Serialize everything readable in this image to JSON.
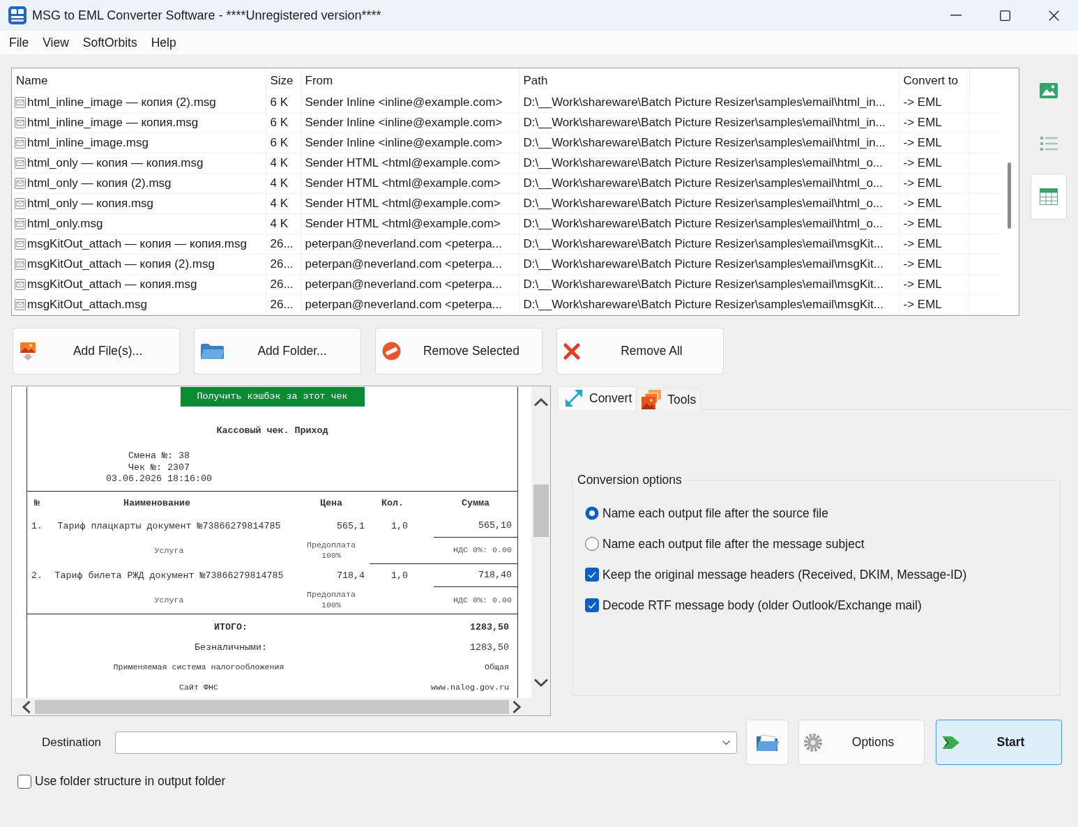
{
  "window": {
    "title": "MSG to EML Converter Software - ****Unregistered version****"
  },
  "menu": [
    {
      "label": "File"
    },
    {
      "label": "View"
    },
    {
      "label": "SoftOrbits"
    },
    {
      "label": "Help"
    }
  ],
  "file_table": {
    "columns": [
      "Name",
      "Size",
      "From",
      "Path",
      "Convert to"
    ],
    "rows": [
      {
        "name": "html_inline_image — копия (2).msg",
        "size": "6 K",
        "from": "Sender Inline <inline@example.com>",
        "path": "D:\\__Work\\shareware\\Batch Picture Resizer\\samples\\email\\html_in...",
        "convert_to": "-> EML"
      },
      {
        "name": "html_inline_image — копия.msg",
        "size": "6 K",
        "from": "Sender Inline <inline@example.com>",
        "path": "D:\\__Work\\shareware\\Batch Picture Resizer\\samples\\email\\html_in...",
        "convert_to": "-> EML"
      },
      {
        "name": "html_inline_image.msg",
        "size": "6 K",
        "from": "Sender Inline <inline@example.com>",
        "path": "D:\\__Work\\shareware\\Batch Picture Resizer\\samples\\email\\html_in...",
        "convert_to": "-> EML"
      },
      {
        "name": "html_only — копия — копия.msg",
        "size": "4 K",
        "from": "Sender HTML <html@example.com>",
        "path": "D:\\__Work\\shareware\\Batch Picture Resizer\\samples\\email\\html_o...",
        "convert_to": "-> EML"
      },
      {
        "name": "html_only — копия (2).msg",
        "size": "4 K",
        "from": "Sender HTML <html@example.com>",
        "path": "D:\\__Work\\shareware\\Batch Picture Resizer\\samples\\email\\html_o...",
        "convert_to": "-> EML"
      },
      {
        "name": "html_only — копия.msg",
        "size": "4 K",
        "from": "Sender HTML <html@example.com>",
        "path": "D:\\__Work\\shareware\\Batch Picture Resizer\\samples\\email\\html_o...",
        "convert_to": "-> EML"
      },
      {
        "name": "html_only.msg",
        "size": "4 K",
        "from": "Sender HTML <html@example.com>",
        "path": "D:\\__Work\\shareware\\Batch Picture Resizer\\samples\\email\\html_o...",
        "convert_to": "-> EML"
      },
      {
        "name": "msgKitOut_attach — копия — копия.msg",
        "size": "26...",
        "from": "peterpan@neverland.com <peterpa...",
        "path": "D:\\__Work\\shareware\\Batch Picture Resizer\\samples\\email\\msgKit...",
        "convert_to": "-> EML"
      },
      {
        "name": "msgKitOut_attach — копия (2).msg",
        "size": "26...",
        "from": "peterpan@neverland.com <peterpa...",
        "path": "D:\\__Work\\shareware\\Batch Picture Resizer\\samples\\email\\msgKit...",
        "convert_to": "-> EML"
      },
      {
        "name": "msgKitOut_attach — копия.msg",
        "size": "26...",
        "from": "peterpan@neverland.com <peterpa...",
        "path": "D:\\__Work\\shareware\\Batch Picture Resizer\\samples\\email\\msgKit...",
        "convert_to": "-> EML"
      },
      {
        "name": "msgKitOut_attach.msg",
        "size": "26...",
        "from": "peterpan@neverland.com <peterpa...",
        "path": "D:\\__Work\\shareware\\Batch Picture Resizer\\samples\\email\\msgKit...",
        "convert_to": "-> EML"
      }
    ]
  },
  "view_buttons": [
    {
      "kind": "thumbnails",
      "selected": false
    },
    {
      "kind": "list",
      "selected": false
    },
    {
      "kind": "details",
      "selected": true
    }
  ],
  "file_buttons": [
    {
      "kind": "add_files",
      "label": "Add File(s)..."
    },
    {
      "kind": "add_folder",
      "label": "Add Folder..."
    },
    {
      "kind": "remove_selected",
      "label": "Remove Selected"
    },
    {
      "kind": "remove_all",
      "label": "Remove All"
    }
  ],
  "preview": {
    "banner": "Получить кэшбэк за этот чек",
    "heading": "Кассовый чек. Приход",
    "info_lines": [
      "Смена №: 38",
      "Чек №: 2307",
      "03.06.2026 18:16:00"
    ],
    "columns": [
      "№",
      "Наименование",
      "Цена",
      "Кол.",
      "Сумма"
    ],
    "items": [
      {
        "number": "1.",
        "name": "Тариф плацкарты документ №73866279814785",
        "price": "565,1",
        "quantity": "1,0",
        "sum": "565,10",
        "type": "Услуга",
        "payment": "Предоплата 100%",
        "vat": "НДС 0%: 0.00"
      },
      {
        "number": "2.",
        "name": "Тариф билета РЖД документ №73866279814785",
        "price": "718,4",
        "quantity": "1,0",
        "sum": "718,40",
        "type": "Услуга",
        "payment": "Предоплата 100%",
        "vat": "НДС 0%: 0.00"
      }
    ],
    "totals": [
      {
        "kind": "total",
        "label": "ИТОГО:",
        "value": "1283,50"
      },
      {
        "kind": "payment",
        "label": "Безналичными:",
        "value": "1283,50"
      },
      {
        "kind": "note",
        "label": "Применяемая система налогообложения",
        "value": "Общая"
      },
      {
        "kind": "note",
        "label": "Сайт ФНС",
        "value": "www.nalog.gov.ru"
      }
    ]
  },
  "tabs": [
    {
      "kind": "convert",
      "label": "Convert",
      "selected": true
    },
    {
      "kind": "tools",
      "label": "Tools",
      "selected": false
    }
  ],
  "conversion_options": {
    "title": "Conversion options",
    "items": [
      {
        "kind": "radio",
        "label": "Name each output file after the source file",
        "selected": true
      },
      {
        "kind": "radio",
        "label": "Name each output file after the message subject",
        "selected": false
      },
      {
        "kind": "checkbox",
        "label": "Keep the original message headers (Received, DKIM, Message-ID)",
        "checked": true
      },
      {
        "kind": "checkbox",
        "label": "Decode RTF message body (older Outlook/Exchange mail)",
        "checked": true
      }
    ]
  },
  "destination": {
    "label": "Destination"
  },
  "action_buttons": [
    {
      "kind": "browse",
      "default": false
    },
    {
      "kind": "options",
      "label": "Options",
      "default": false
    },
    {
      "kind": "start",
      "label": "Start",
      "default": true
    }
  ],
  "use_folder_structure": {
    "label": "Use folder structure in output folder",
    "checked": false
  }
}
